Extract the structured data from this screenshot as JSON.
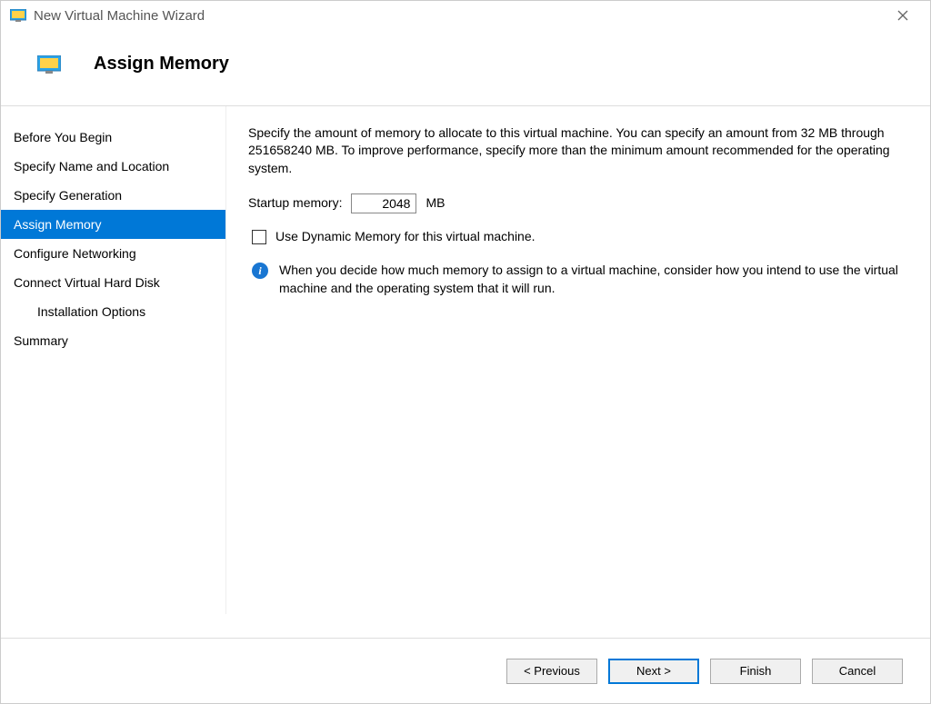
{
  "titlebar": {
    "title": "New Virtual Machine Wizard"
  },
  "header": {
    "title": "Assign Memory"
  },
  "sidebar": {
    "items": [
      {
        "label": "Before You Begin",
        "selected": false,
        "indent": false
      },
      {
        "label": "Specify Name and Location",
        "selected": false,
        "indent": false
      },
      {
        "label": "Specify Generation",
        "selected": false,
        "indent": false
      },
      {
        "label": "Assign Memory",
        "selected": true,
        "indent": false
      },
      {
        "label": "Configure Networking",
        "selected": false,
        "indent": false
      },
      {
        "label": "Connect Virtual Hard Disk",
        "selected": false,
        "indent": false
      },
      {
        "label": "Installation Options",
        "selected": false,
        "indent": true
      },
      {
        "label": "Summary",
        "selected": false,
        "indent": false
      }
    ]
  },
  "content": {
    "description": "Specify the amount of memory to allocate to this virtual machine. You can specify an amount from 32 MB through 251658240 MB. To improve performance, specify more than the minimum amount recommended for the operating system.",
    "startup_label": "Startup memory:",
    "startup_value": "2048",
    "startup_unit": "MB",
    "dynamic_checkbox_label": "Use Dynamic Memory for this virtual machine.",
    "dynamic_checked": false,
    "info_text": "When you decide how much memory to assign to a virtual machine, consider how you intend to use the virtual machine and the operating system that it will run."
  },
  "footer": {
    "previous": "< Previous",
    "next": "Next >",
    "finish": "Finish",
    "cancel": "Cancel"
  },
  "colors": {
    "accent": "#0078d7"
  }
}
